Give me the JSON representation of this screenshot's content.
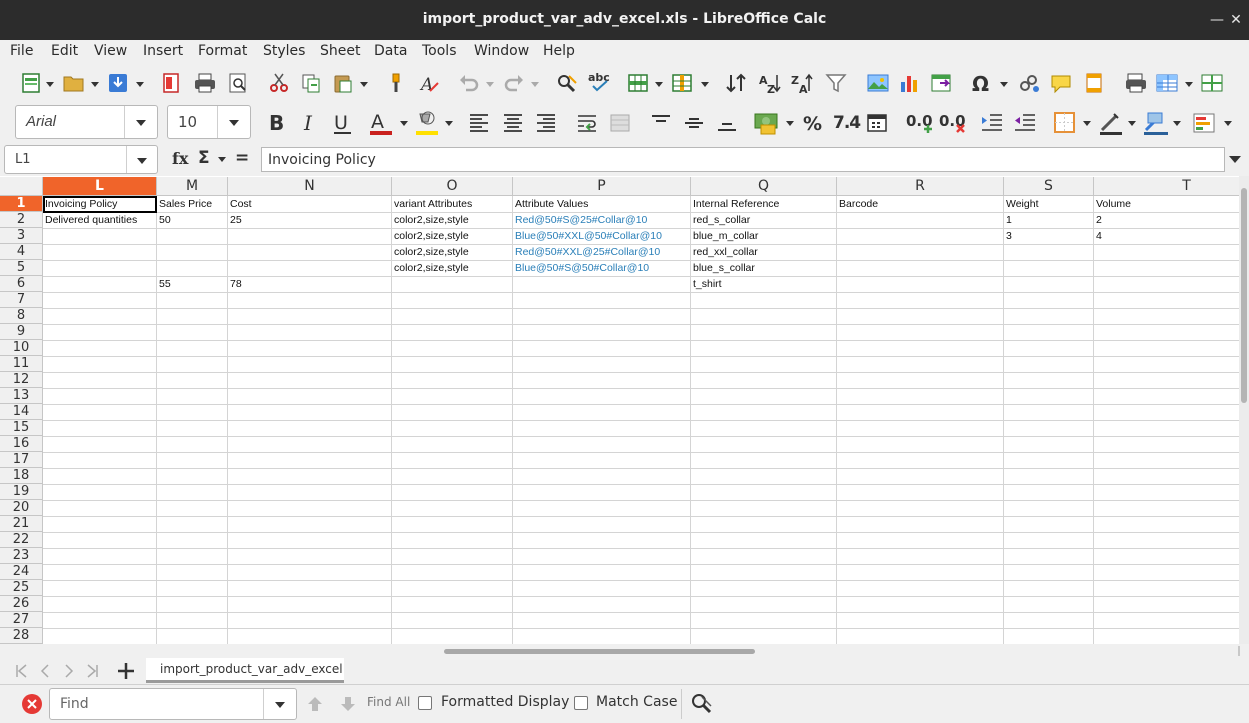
{
  "window": {
    "title": "import_product_var_adv_excel.xls - LibreOffice Calc"
  },
  "menu": [
    "File",
    "Edit",
    "View",
    "Insert",
    "Format",
    "Styles",
    "Sheet",
    "Data",
    "Tools",
    "Window",
    "Help"
  ],
  "font_bar": {
    "font_name": "Arial",
    "font_size": "10"
  },
  "number_format_label": "7.4",
  "formula_bar": {
    "cell_ref": "L1",
    "fx_label": "fx",
    "sum_label": "Σ",
    "equals_label": "=",
    "content": "Invoicing Policy"
  },
  "columns": [
    "L",
    "M",
    "N",
    "O",
    "P",
    "Q",
    "R",
    "S",
    "T"
  ],
  "selected_column": "L",
  "rows": [
    "1",
    "2",
    "3",
    "4",
    "5",
    "6",
    "7",
    "8",
    "9",
    "10",
    "11",
    "12",
    "13",
    "14",
    "15",
    "16",
    "17",
    "18",
    "19",
    "20",
    "21",
    "22",
    "23",
    "24",
    "25",
    "26",
    "27",
    "28"
  ],
  "selected_row": "1",
  "cells": {
    "r1": [
      "Invoicing Policy",
      "Sales Price",
      "Cost",
      "variant Attributes",
      "Attribute Values",
      "Internal Reference",
      "Barcode",
      "Weight",
      "Volume"
    ],
    "r2": [
      "Delivered quantities",
      "50",
      "25",
      "color2,size,style",
      "Red@50#S@25#Collar@10",
      "red_s_collar",
      "",
      "1",
      "2"
    ],
    "r3": [
      "",
      "",
      "",
      "color2,size,style",
      "Blue@50#XXL@50#Collar@10",
      "blue_m_collar",
      "",
      "3",
      "4"
    ],
    "r4": [
      "",
      "",
      "",
      "color2,size,style",
      "Red@50#XXL@25#Collar@10",
      "red_xxl_collar",
      "",
      "",
      ""
    ],
    "r5": [
      "",
      "",
      "",
      "color2,size,style",
      "Blue@50#S@50#Collar@10",
      "blue_s_collar",
      "",
      "",
      ""
    ],
    "r6": [
      "",
      "55",
      "78",
      "",
      "",
      "t_shirt",
      "",
      "",
      ""
    ]
  },
  "sheet_tab": "import_product_var_adv_excel",
  "find_bar": {
    "placeholder": "Find",
    "find_all": "Find All",
    "formatted_display": "Formatted Display",
    "match_case": "Match Case"
  },
  "colors": {
    "selection": "#f0642a",
    "link_text": "#2a7fb8",
    "titlebar": "#2c2c2c"
  }
}
